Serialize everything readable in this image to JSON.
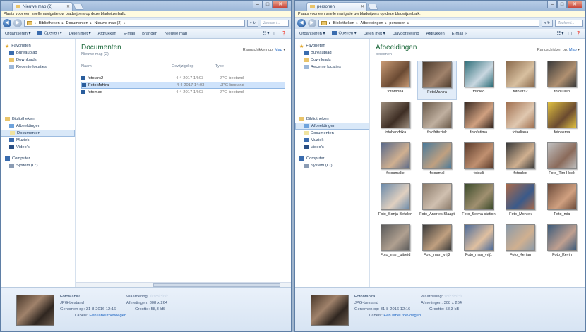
{
  "left": {
    "tab_title": "Nieuwe map (2)",
    "infobar": "Plaats voor een snelle navigatie uw bladwijzers op deze bladwijzerbalk.",
    "address": [
      "Bibliotheken",
      "Documenten",
      "Nieuwe map (2)"
    ],
    "search_placeholder": "Zoeken i...",
    "toolbar": [
      "Organiseren",
      "Openen",
      "Delen met",
      "Afdrukken",
      "E-mail",
      "Branden",
      "Nieuwe map"
    ],
    "library_title": "Documenten",
    "library_sub": "Nieuwe map (2)",
    "arrange_label": "Rangschikken op:",
    "arrange_value": "Map",
    "columns": [
      "Naam",
      "Gewijzigd op",
      "Type"
    ],
    "files": [
      {
        "name": "fotolars2",
        "date": "4-4-2017 14:03",
        "type": "JPG-bestand"
      },
      {
        "name": "FotoMahira",
        "date": "4-4-2017 14:03",
        "type": "JPG-bestand"
      },
      {
        "name": "fotomax",
        "date": "4-4-2017 14:03",
        "type": "JPG-bestand"
      }
    ]
  },
  "right": {
    "tab_title": "personen",
    "infobar": "Plaats voor een snelle navigatie uw bladwijzers op deze bladwijzerbalk.",
    "address": [
      "Bibliotheken",
      "Afbeeldingen",
      "personen"
    ],
    "search_placeholder": "Zoeken i...",
    "toolbar": [
      "Organiseren",
      "Openen",
      "Delen met",
      "Diavoorstelling",
      "Afdrukken",
      "E-mail"
    ],
    "library_title": "Afbeeldingen",
    "library_sub": "personen",
    "arrange_label": "Rangschikken op:",
    "arrange_value": "Map",
    "thumbs": [
      "fotomona",
      "FotoMahira",
      "fotoleo",
      "fotolars2",
      "fotojulien",
      "fotohendrika",
      "fotofritsziek",
      "fotofatima",
      "fotodiana",
      "fotoasma",
      "fotoamalie",
      "fotoamal",
      "fotoali",
      "fotoalex",
      "Foto_Tim Hoek",
      "Foto_Sonja Betalen",
      "Foto_Andries Slaapt",
      "Foto_Selma station",
      "Foto_Moniek",
      "Foto_mia",
      "Foto_man_uitreid",
      "Foto_man_vrij2",
      "Foto_man_vrij1",
      "Foto_Kerian",
      "Foto_Kevin"
    ]
  },
  "nav": {
    "favorites": "Favorieten",
    "desktop": "Bureaublad",
    "downloads": "Downloads",
    "recent": "Recente locaties",
    "libraries": "Bibliotheken",
    "pictures": "Afbeeldingen",
    "documents": "Documenten",
    "music": "Muziek",
    "videos": "Video's",
    "computer": "Computer",
    "system": "System (C:)"
  },
  "details": {
    "name": "FotoMahira",
    "type": "JPG-bestand",
    "taken": "Genomen op: 31-8-2016 12:16",
    "labels_label": "Labels:",
    "labels_value": "Een label toevoegen",
    "rating_label": "Waardering:",
    "rating_stars": "☆☆☆☆☆",
    "dim_label": "Afmetingen:",
    "dim_value": "308 x 264",
    "size_label": "Grootte:",
    "size_value": "58,3 kB"
  }
}
